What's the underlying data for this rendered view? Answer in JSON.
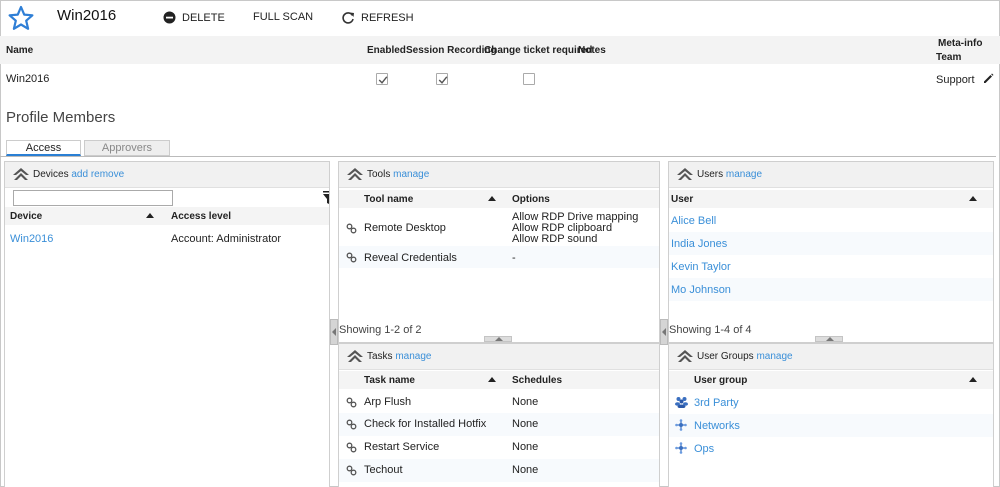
{
  "header": {
    "title": "Win2016",
    "delete_label": "DELETE",
    "fullscan_label": "FULL SCAN",
    "refresh_label": "REFRESH"
  },
  "meta_table": {
    "columns": {
      "name": "Name",
      "enabled": "Enabled",
      "session_recording": "Session Recording",
      "change_ticket": "Change ticket required",
      "notes": "Notes",
      "meta_info": "Meta-info",
      "team": "Team"
    },
    "row": {
      "name": "Win2016",
      "enabled": true,
      "session_recording": true,
      "change_ticket": false,
      "team": "Support"
    }
  },
  "profile_members": {
    "title": "Profile Members",
    "tabs": [
      {
        "label": "Access",
        "active": true
      },
      {
        "label": "Approvers",
        "active": false
      }
    ]
  },
  "devices": {
    "title": "Devices",
    "add_label": "add",
    "remove_label": "remove",
    "filter_value": "",
    "columns": {
      "device": "Device",
      "access_level": "Access level"
    },
    "rows": [
      {
        "device": "Win2016",
        "access_level": "Account: Administrator"
      }
    ]
  },
  "tools": {
    "title": "Tools",
    "manage_label": "manage",
    "columns": {
      "name": "Tool name",
      "options": "Options"
    },
    "rows": [
      {
        "name": "Remote Desktop",
        "options": [
          "Allow RDP Drive mapping",
          "Allow RDP clipboard",
          "Allow RDP sound"
        ]
      },
      {
        "name": "Reveal Credentials",
        "options": [
          "-"
        ]
      }
    ],
    "showing": "Showing 1-2 of 2"
  },
  "tasks": {
    "title": "Tasks",
    "manage_label": "manage",
    "columns": {
      "name": "Task name",
      "schedules": "Schedules"
    },
    "rows": [
      {
        "name": "Arp Flush",
        "schedule": "None"
      },
      {
        "name": "Check for Installed Hotfix",
        "schedule": "None"
      },
      {
        "name": "Restart Service",
        "schedule": "None"
      },
      {
        "name": "Techout",
        "schedule": "None"
      }
    ]
  },
  "users": {
    "title": "Users",
    "manage_label": "manage",
    "columns": {
      "user": "User"
    },
    "rows": [
      "Alice Bell",
      "India Jones",
      "Kevin Taylor",
      "Mo Johnson"
    ],
    "showing": "Showing 1-4 of 4"
  },
  "user_groups": {
    "title": "User Groups",
    "manage_label": "manage",
    "columns": {
      "group": "User group"
    },
    "rows": [
      {
        "name": "3rd Party",
        "icon": "people-group-icon"
      },
      {
        "name": "Networks",
        "icon": "network-group-icon"
      },
      {
        "name": "Ops",
        "icon": "network-group-icon"
      }
    ]
  },
  "colors": {
    "accent": "#3a8fd8",
    "tab_underline": "#2a7fd4",
    "star": "#2f7fd6"
  }
}
